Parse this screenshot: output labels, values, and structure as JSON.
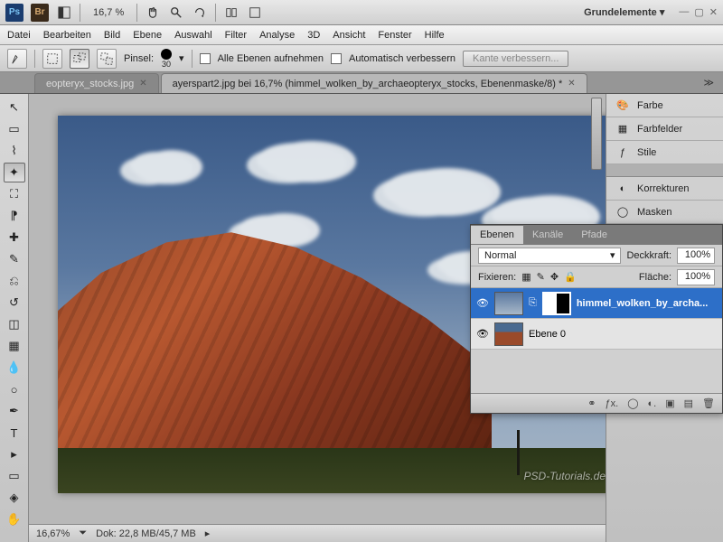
{
  "titlebar": {
    "zoom": "16,7 %",
    "workspace": "Grundelemente ▾"
  },
  "menu": [
    "Datei",
    "Bearbeiten",
    "Bild",
    "Ebene",
    "Auswahl",
    "Filter",
    "Analyse",
    "3D",
    "Ansicht",
    "Fenster",
    "Hilfe"
  ],
  "options": {
    "brush_label": "Pinsel:",
    "brush_size": "30",
    "all_layers": "Alle Ebenen aufnehmen",
    "auto_enhance": "Automatisch verbessern",
    "refine_edge": "Kante verbessern..."
  },
  "tabs": [
    {
      "label": "eopteryx_stocks.jpg",
      "active": false
    },
    {
      "label": "ayerspart2.jpg bei 16,7% (himmel_wolken_by_archaeopteryx_stocks, Ebenenmaske/8) *",
      "active": true
    }
  ],
  "right_panels": [
    "Farbe",
    "Farbfelder",
    "Stile",
    "Korrekturen",
    "Masken"
  ],
  "layers_panel": {
    "tabs": [
      "Ebenen",
      "Kanäle",
      "Pfade"
    ],
    "blend_mode": "Normal",
    "opacity_label": "Deckkraft:",
    "opacity": "100%",
    "lock_label": "Fixieren:",
    "fill_label": "Fläche:",
    "fill": "100%",
    "layers": [
      {
        "name": "himmel_wolken_by_archa...",
        "selected": true,
        "has_mask": true
      },
      {
        "name": "Ebene 0",
        "selected": false,
        "has_mask": false
      }
    ]
  },
  "status": {
    "zoom": "16,67%",
    "doc": "Dok: 22,8 MB/45,7 MB"
  },
  "watermark": "PSD-Tutorials.de"
}
